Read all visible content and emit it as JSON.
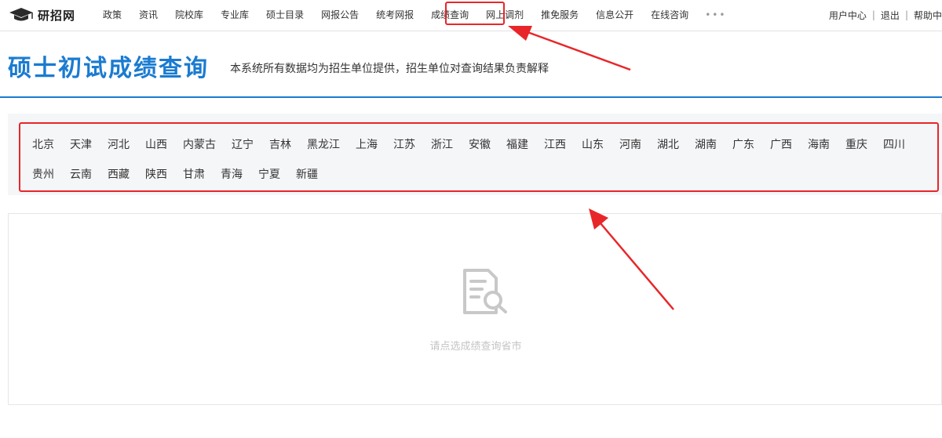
{
  "nav": {
    "logo_text": "研招网",
    "items": [
      "政策",
      "资讯",
      "院校库",
      "专业库",
      "硕士目录",
      "网报公告",
      "统考网报",
      "成绩查询",
      "网上调剂",
      "推免服务",
      "信息公开",
      "在线咨询"
    ],
    "more": "•••",
    "user_center": "用户中心",
    "logout": "退出",
    "help": "帮助中"
  },
  "header": {
    "title": "硕士初试成绩查询",
    "subtitle": "本系统所有数据均为招生单位提供，招生单位对查询结果负责解释"
  },
  "provinces": {
    "row1": [
      "北京",
      "天津",
      "河北",
      "山西",
      "内蒙古",
      "辽宁",
      "吉林",
      "黑龙江",
      "上海",
      "江苏",
      "浙江",
      "安徽",
      "福建",
      "江西",
      "山东",
      "河南",
      "湖北",
      "湖南",
      "广东",
      "广西",
      "海南",
      "重庆",
      "四川"
    ],
    "row2": [
      "贵州",
      "云南",
      "西藏",
      "陕西",
      "甘肃",
      "青海",
      "宁夏",
      "新疆"
    ]
  },
  "result": {
    "empty_text": "请点选成绩查询省市",
    "icon": "document-search-icon"
  },
  "colors": {
    "accent": "#1a7bd1",
    "annotation": "#e8262a"
  }
}
